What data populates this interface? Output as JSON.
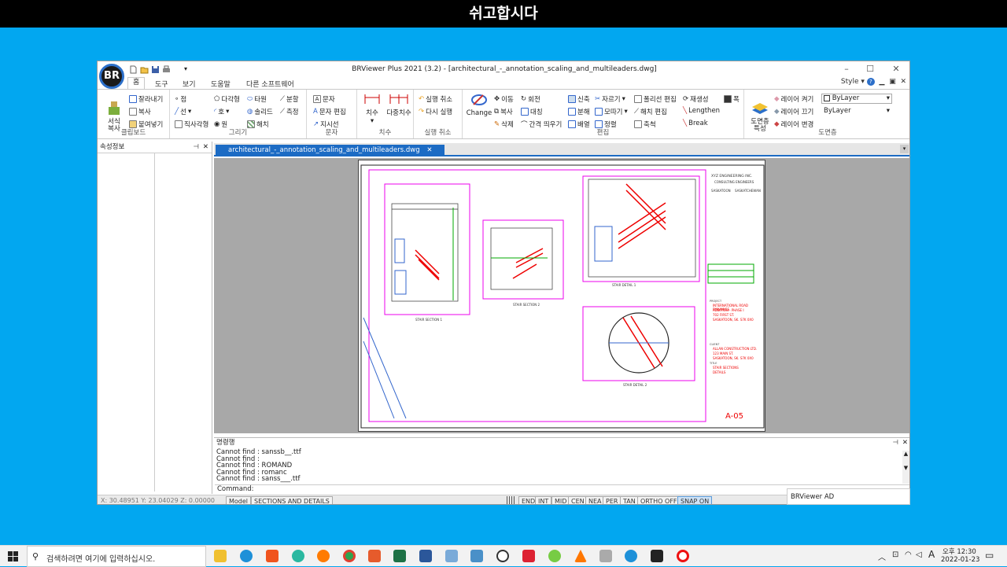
{
  "banner": "쉬고합시다",
  "app": {
    "title": "BRViewer Plus 2021 (3.2) - [architectural_-_annotation_scaling_and_multileaders.dwg]",
    "logo": "BR"
  },
  "ribbon_tabs": [
    "홈",
    "도구",
    "보기",
    "도움말",
    "다른 소프트웨어"
  ],
  "style_label": "Style",
  "groups": {
    "clipboard": {
      "label": "클립보드",
      "format": "서식\n복사",
      "cut": "잘라내기",
      "copy": "복사",
      "paste": "붙여넣기"
    },
    "draw": {
      "label": "그리기",
      "point": "점",
      "line": "선",
      "rect": "직사각형",
      "polygon": "다각형",
      "arc": "호",
      "circle": "원",
      "ellipse": "타원",
      "spline": "솔리드",
      "hatch": "해치",
      "divide": "분할",
      "measure": "측정"
    },
    "text": {
      "label": "문자",
      "text": "문자",
      "edit": "문자 편집",
      "leader": "지시선"
    },
    "dim": {
      "label": "치수",
      "dim": "치수",
      "multi": "다중치수"
    },
    "undo": {
      "label": "실행 취소",
      "undo": "실행 취소",
      "redo": "다시 실행"
    },
    "edit": {
      "label": "편집",
      "change": "Change",
      "move": "이동",
      "copy": "복사",
      "delete": "삭제",
      "rotate": "회전",
      "mirror": "대칭",
      "offset": "간격 띄우기",
      "stretch": "신축",
      "explode": "분해",
      "array": "배열",
      "trim": "자르기",
      "chamfer": "모따기",
      "align": "정렬",
      "pedit": "폴리선 편집",
      "hatchedit": "해치 편집",
      "scale": "축척",
      "regen": "재생성",
      "lengthen": "Lengthen",
      "break": "Break",
      "width": "폭"
    },
    "layer": {
      "label": "도면층",
      "props": "도면층\n특성",
      "on": "레이어 켜기",
      "off": "레이어 끄기",
      "change": "레이어 변경",
      "combo1": "ByLayer",
      "combo2": "ByLayer"
    }
  },
  "left_panel": {
    "title": "속성정보"
  },
  "doc_tab": "architectural_-_annotation_scaling_and_multileaders.dwg",
  "drawing": {
    "company": "XYZ ENGINEERING INC.",
    "company_sub": "CONSULTING ENGINEERS",
    "city1": "SASKATOON",
    "city2": "SASKATCHEWAN",
    "project_head": "PROJECT",
    "project": "INTERNATIONAL ROAD DYNAMICS",
    "project_addr": "ADDITION - PHASE I",
    "project_addr2": "702 FIRST ST.",
    "project_addr3": "SASKATOON, SK. S7K 0X0",
    "client_head": "CLIENT",
    "client": "ALLAN CONSTRUCTION LTD.",
    "client_addr": "123 MAIN ST.",
    "client_addr2": "SASKATOON, SK. S7K 0X0",
    "title_head": "TITLE",
    "title": "STAIR SECTIONS",
    "title2": "DETAILS",
    "sheet_no": "A-05",
    "labels": [
      "STAIR SECTION 1",
      "STAIR SECTION 2",
      "STAIR DETAIL 1",
      "STAIR DETAIL 2"
    ]
  },
  "command": {
    "title": "명령행",
    "lines": [
      "Cannot find : sanssb__.ttf",
      "Cannot find :",
      "Cannot find : ROMAND",
      "Cannot find : romanc",
      "Cannot find : sanss___.ttf"
    ],
    "prompt": "Command:"
  },
  "status": {
    "coords": "X: 30.48951   Y: 23.04029   Z: 0.00000",
    "model": "Model",
    "layout": "SECTIONS AND DETAILS",
    "snaps": [
      "END",
      "INT",
      "MID",
      "CEN",
      "NEA",
      "PER",
      "TAN",
      "ORTHO OFF",
      "SNAP ON"
    ]
  },
  "popup": "BRViewer AD",
  "taskbar": {
    "search": "검색하려면 여기에 입력하십시오.",
    "time": "오후 12:30",
    "date": "2022-01-23",
    "lang": "A"
  }
}
